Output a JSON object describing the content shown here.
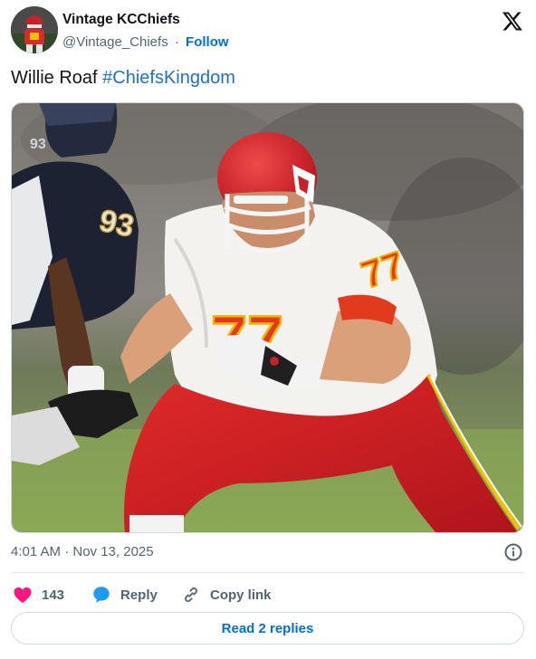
{
  "author": {
    "display_name": "Vintage KCChiefs",
    "handle": "@Vintage_Chiefs",
    "separator": "·",
    "follow_label": "Follow"
  },
  "tweet": {
    "text": "Willie Roaf",
    "hashtag": "#ChiefsKingdom",
    "photo_jersey_number": "77",
    "photo_jersey_number_opponent": "93"
  },
  "meta": {
    "timestamp": "4:01 AM · Nov 13, 2025"
  },
  "actions": {
    "like_count": "143",
    "reply_label": "Reply",
    "copy_label": "Copy link"
  },
  "footer": {
    "read_replies_label": "Read 2 replies"
  },
  "colors": {
    "link_blue": "#006fd6",
    "heart_pink": "#f91880",
    "reply_blue": "#1d9bf0",
    "muted_gray": "#536471",
    "chiefs_red": "#d01f2a"
  }
}
